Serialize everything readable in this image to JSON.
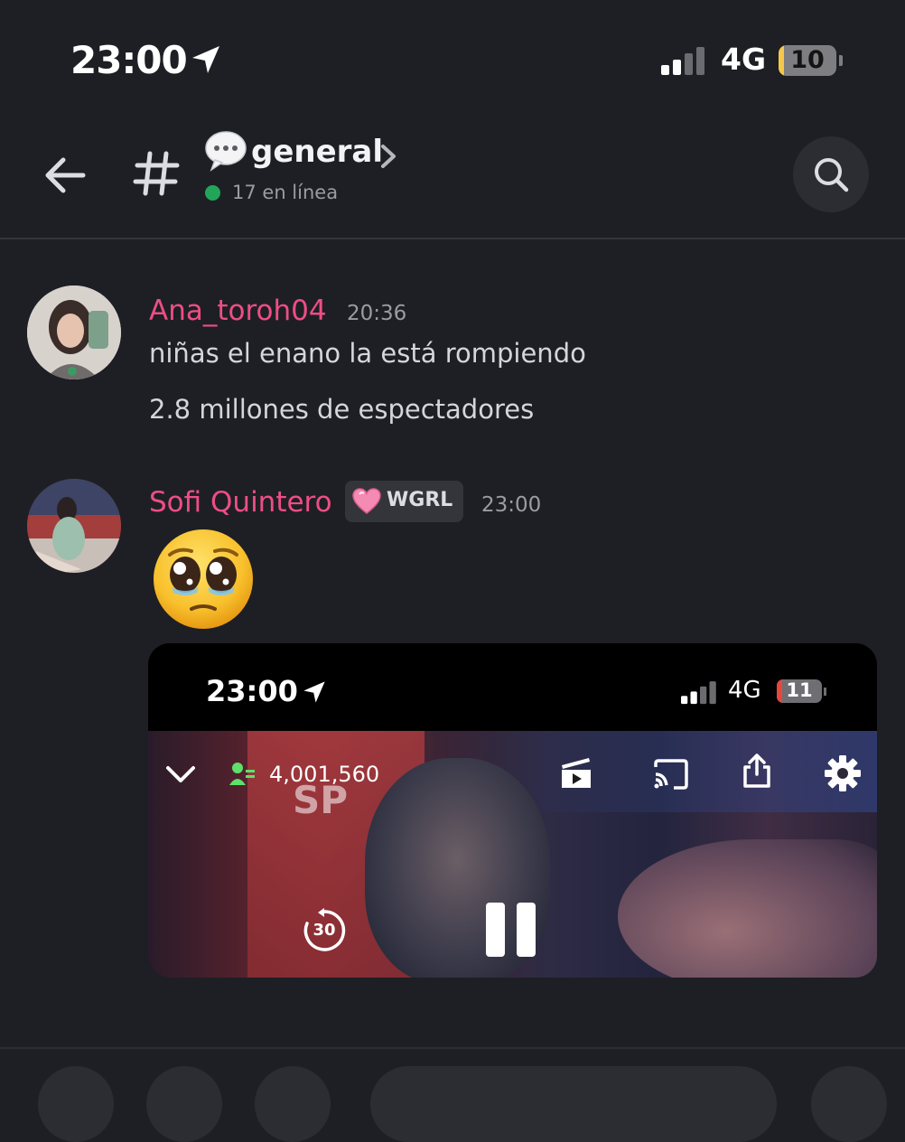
{
  "status_bar": {
    "time": "23:00",
    "network": "4G",
    "battery": "10",
    "battery_level_percent": 10
  },
  "header": {
    "channel_name": "general",
    "online_status": "17 en línea"
  },
  "messages": [
    {
      "username": "Ana_toroh04",
      "time": "20:36",
      "lines": [
        "niñas el enano la está rompiendo",
        "2.8 millones de espectadores"
      ],
      "username_color": "#ed4e84"
    },
    {
      "username": "Sofi Quintero",
      "role_tag": "WGRL",
      "time": "23:00",
      "emoji": "pleading-face",
      "username_color": "#ed4e84"
    }
  ],
  "video_embed": {
    "time": "23:00",
    "network": "4G",
    "battery": "11",
    "battery_level_percent": 11,
    "viewer_count": "4,001,560",
    "rewind_seconds": "30"
  },
  "colors": {
    "background": "#1e1f24",
    "online": "#23a559",
    "username": "#ed4e84"
  }
}
